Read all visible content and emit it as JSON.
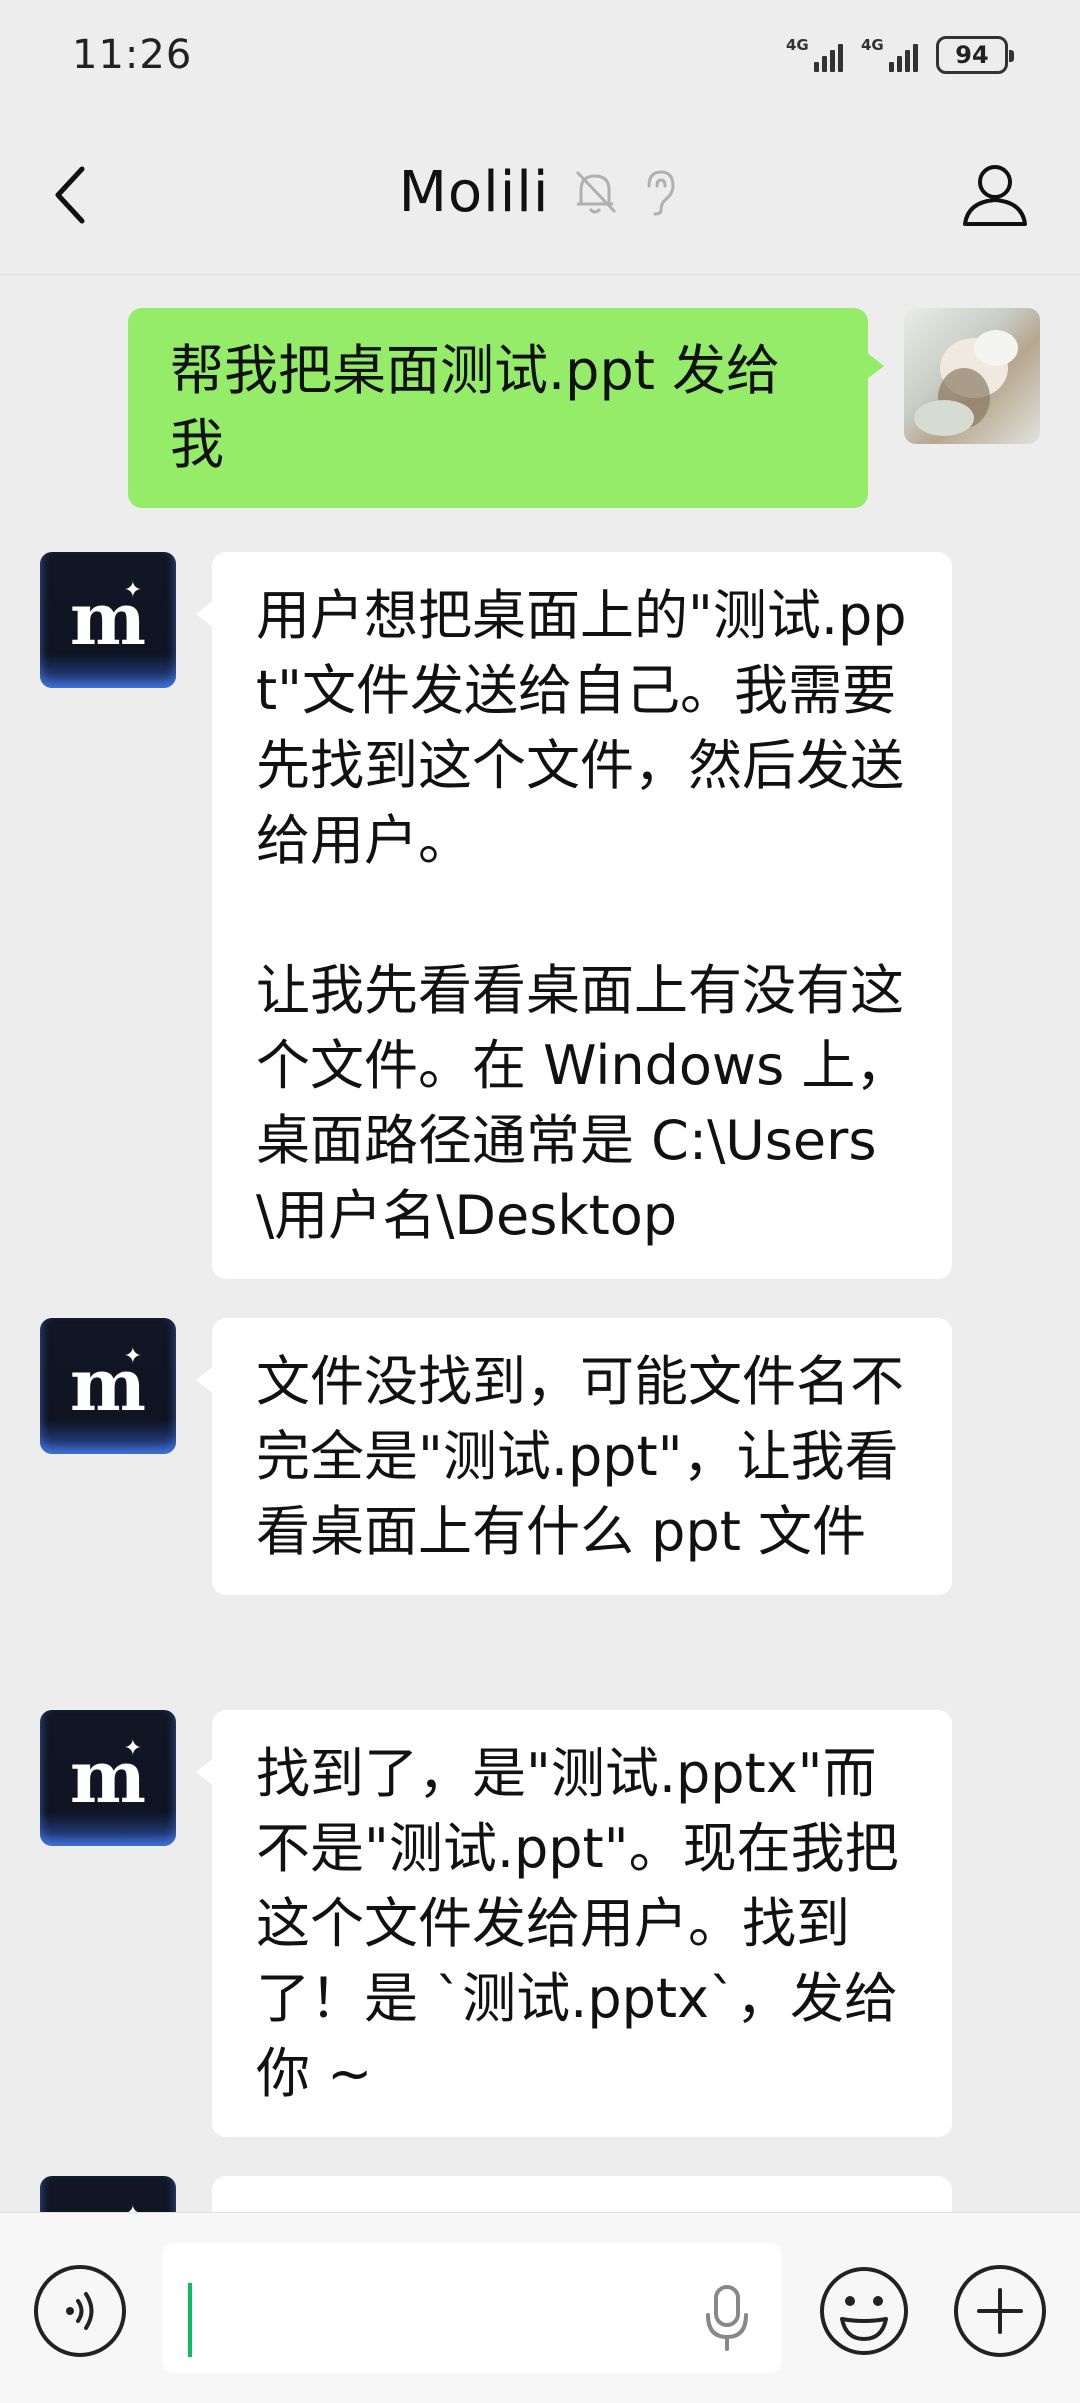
{
  "status": {
    "time": "11:26",
    "signal1": "4G",
    "signal2": "4G",
    "battery": "94"
  },
  "header": {
    "title": "Molili"
  },
  "messages": [
    {
      "from": "user",
      "text": "帮我把桌面测试.ppt 发给我"
    },
    {
      "from": "bot",
      "text": "用户想把桌面上的\"测试.ppt\"文件发送给自己。我需要先找到这个文件，然后发送给用户。\n\n让我先看看桌面上有没有这个文件。在 Windows 上，桌面路径通常是 C:\\Users\\用户名\\Desktop"
    },
    {
      "from": "bot",
      "text": "文件没找到，可能文件名不完全是\"测试.ppt\"，让我看看桌面上有什么 ppt 文件"
    },
    {
      "from": "bot",
      "text": "找到了，是\"测试.pptx\"而不是\"测试.ppt\"。现在我把这个文件发给用户。找到了！是 `测试.pptx`，发给你 ~"
    }
  ],
  "input": {
    "value": ""
  },
  "colors": {
    "outgoing_bubble": "#95ec69",
    "incoming_bubble": "#ffffff",
    "background": "#ededed",
    "caret": "#07c160"
  }
}
